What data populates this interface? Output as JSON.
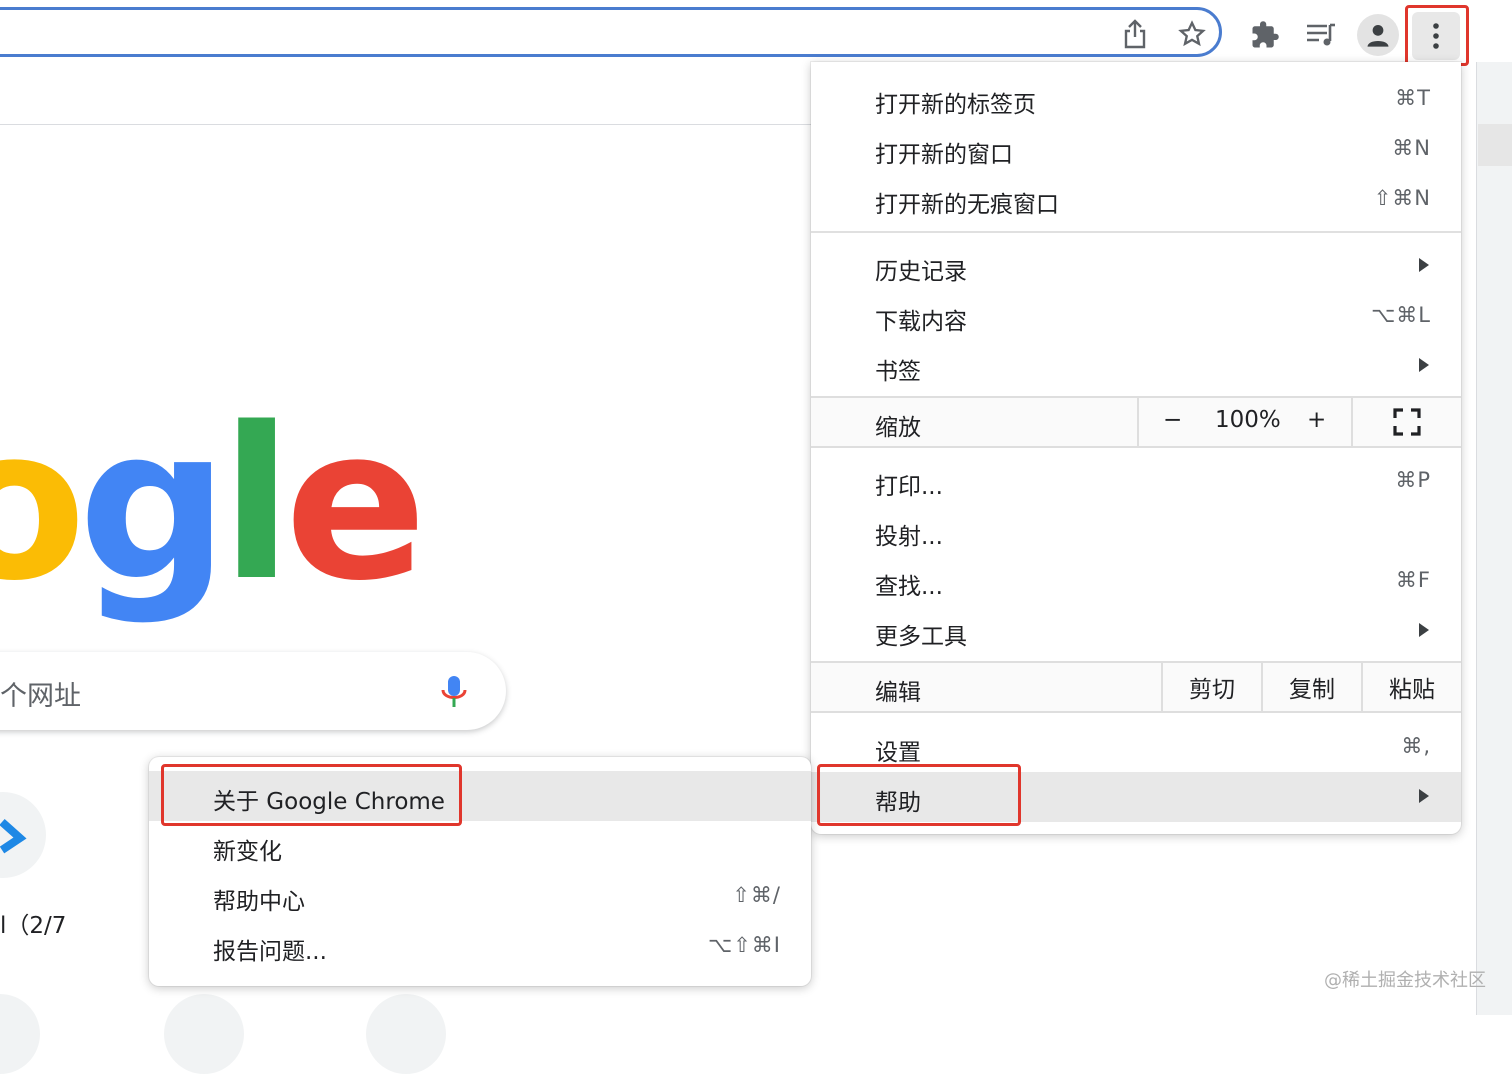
{
  "toolbar": {
    "icons": [
      "share-icon",
      "star-icon",
      "extensions-icon",
      "media-icon",
      "profile-icon",
      "more-menu-icon"
    ]
  },
  "page": {
    "logo_visible": "ogle",
    "search_placeholder": "个网址",
    "shortcut_label": "l（2/7",
    "watermark": "@稀土掘金技术社区",
    "logo_colors": [
      "#fbbc05",
      "#4285f4",
      "#34a853",
      "#ea4335"
    ]
  },
  "menu": {
    "new_tab": {
      "label": "打开新的标签页",
      "shortcut": "⌘T"
    },
    "new_window": {
      "label": "打开新的窗口",
      "shortcut": "⌘N"
    },
    "incognito": {
      "label": "打开新的无痕窗口",
      "shortcut": "⇧⌘N"
    },
    "history": {
      "label": "历史记录"
    },
    "downloads": {
      "label": "下载内容",
      "shortcut": "⌥⌘L"
    },
    "bookmarks": {
      "label": "书签"
    },
    "zoom": {
      "label": "缩放",
      "minus": "−",
      "value": "100%",
      "plus": "+"
    },
    "print": {
      "label": "打印...",
      "shortcut": "⌘P"
    },
    "cast": {
      "label": "投射..."
    },
    "find": {
      "label": "查找...",
      "shortcut": "⌘F"
    },
    "more_tools": {
      "label": "更多工具"
    },
    "edit": {
      "label": "编辑",
      "cut": "剪切",
      "copy": "复制",
      "paste": "粘贴"
    },
    "settings": {
      "label": "设置",
      "shortcut": "⌘,"
    },
    "help": {
      "label": "帮助"
    }
  },
  "help_submenu": {
    "about": {
      "label": "关于 Google Chrome"
    },
    "whats_new": {
      "label": "新变化"
    },
    "help_center": {
      "label": "帮助中心",
      "shortcut": "⇧⌘/"
    },
    "report": {
      "label": "报告问题...",
      "shortcut": "⌥⇧⌘I"
    }
  },
  "colors": {
    "highlight_box": "#e0362c",
    "omnibox_border": "#4a7ccf"
  }
}
